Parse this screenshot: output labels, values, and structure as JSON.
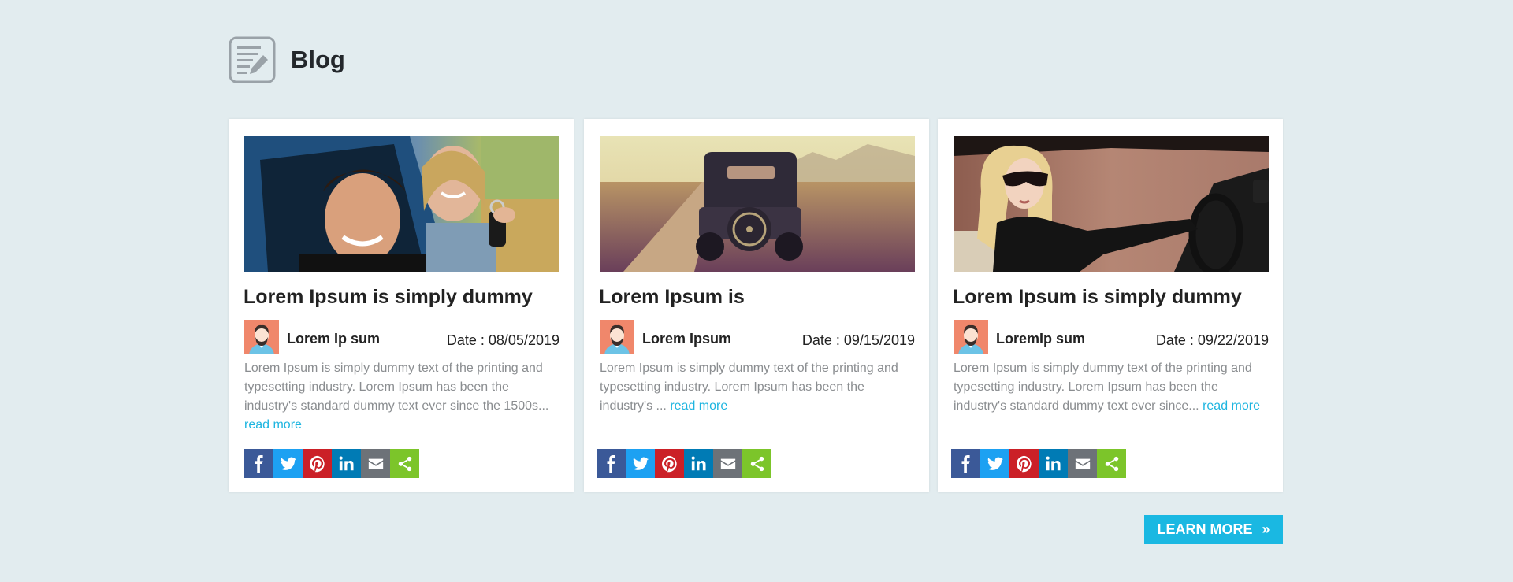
{
  "page": {
    "title": "Blog",
    "icon": "blog-edit-icon",
    "accent_color": "#1ab8e2",
    "background_color": "#e2ecef"
  },
  "posts": [
    {
      "title": "Lorem Ipsum is simply dummy",
      "author": "Lorem Ip sum",
      "date": "Date : 08/05/2019",
      "excerpt": "Lorem Ipsum is simply dummy text of the printing and typesetting industry. Lorem Ipsum has been the industry's standard dummy text ever since the 1500s...",
      "read_more": "read more",
      "image": "couple-in-car-photo"
    },
    {
      "title": "Lorem Ipsum is",
      "author": "Lorem Ipsum",
      "date": "Date : 09/15/2019",
      "excerpt": "Lorem Ipsum is simply dummy text of the printing and typesetting industry. Lorem Ipsum has been the industry's ...",
      "read_more": "read more",
      "image": "vintage-car-road-photo"
    },
    {
      "title": "Lorem Ipsum is simply dummy",
      "author": "LoremIp sum",
      "date": "Date : 09/22/2019",
      "excerpt": "Lorem Ipsum is simply dummy text of the printing and typesetting industry. Lorem Ipsum has been the industry's standard dummy text ever since...",
      "read_more": "read more",
      "image": "woman-driving-photo"
    }
  ],
  "share_buttons": [
    {
      "icon": "facebook-icon",
      "color": "#3b5998"
    },
    {
      "icon": "twitter-icon",
      "color": "#1da1f2"
    },
    {
      "icon": "pinterest-icon",
      "color": "#cb2027"
    },
    {
      "icon": "linkedin-icon",
      "color": "#007bb5"
    },
    {
      "icon": "email-icon",
      "color": "#6d7278"
    },
    {
      "icon": "share-icon",
      "color": "#7cc52a"
    }
  ],
  "learn_more": {
    "label": "LEARN MORE",
    "icon": "double-chevron-right-icon"
  }
}
